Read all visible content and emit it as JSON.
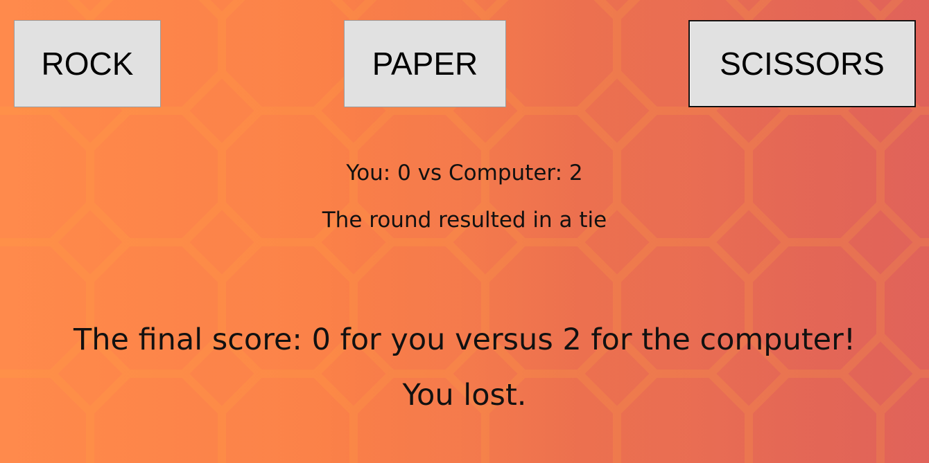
{
  "buttons": {
    "rock": "ROCK",
    "paper": "PAPER",
    "scissors": "SCISSORS"
  },
  "score_line": "You: 0 vs Computer: 2",
  "round_result": "The round resulted in a tie",
  "final_score": "The final score: 0 for you versus 2 for the computer!",
  "outcome": "You lost.",
  "colors": {
    "background_left": "#ff8a4c",
    "background_right": "#e0625a",
    "button_fill": "#e1e1e1",
    "text": "#111111"
  }
}
